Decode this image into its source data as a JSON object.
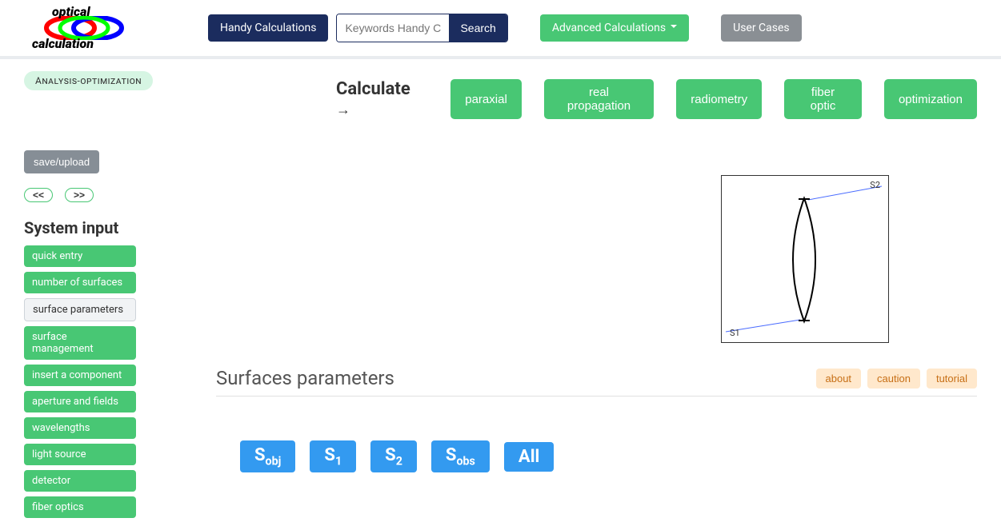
{
  "topbar": {
    "handy": "Handy Calculations",
    "search_placeholder": "Keywords Handy Calc...",
    "search": "Search",
    "advanced": "Advanced Calculations",
    "user_cases": "User Cases"
  },
  "logo": {
    "top": "optical",
    "bottom": "calculation"
  },
  "sidebar": {
    "badge": "Analysis-optimization",
    "save": "save/upload",
    "prev": "<<",
    "next": ">>",
    "title": "System input",
    "items": [
      {
        "label": "quick entry",
        "active": false
      },
      {
        "label": "number of surfaces",
        "active": false
      },
      {
        "label": "surface parameters",
        "active": true
      },
      {
        "label": "surface management",
        "active": false
      },
      {
        "label": "insert a component",
        "active": false
      },
      {
        "label": "aperture and fields",
        "active": false
      },
      {
        "label": "wavelengths",
        "active": false
      },
      {
        "label": "light source",
        "active": false
      },
      {
        "label": "detector",
        "active": false
      },
      {
        "label": "fiber optics",
        "active": false
      }
    ]
  },
  "calc": {
    "label": "Calculate",
    "buttons": [
      "paraxial",
      "real propagation",
      "radiometry",
      "fiber optic",
      "optimization"
    ]
  },
  "lens": {
    "s1": "S1",
    "s2": "S2"
  },
  "surfaces": {
    "title": "Surfaces parameters",
    "about": "about",
    "caution": "caution",
    "tutorial": "tutorial",
    "tabs": {
      "sobj_main": "S",
      "sobj_sub": "obj",
      "s1_main": "S",
      "s1_sub": "1",
      "s2_main": "S",
      "s2_sub": "2",
      "sobs_main": "S",
      "sobs_sub": "obs",
      "all": "All"
    }
  }
}
